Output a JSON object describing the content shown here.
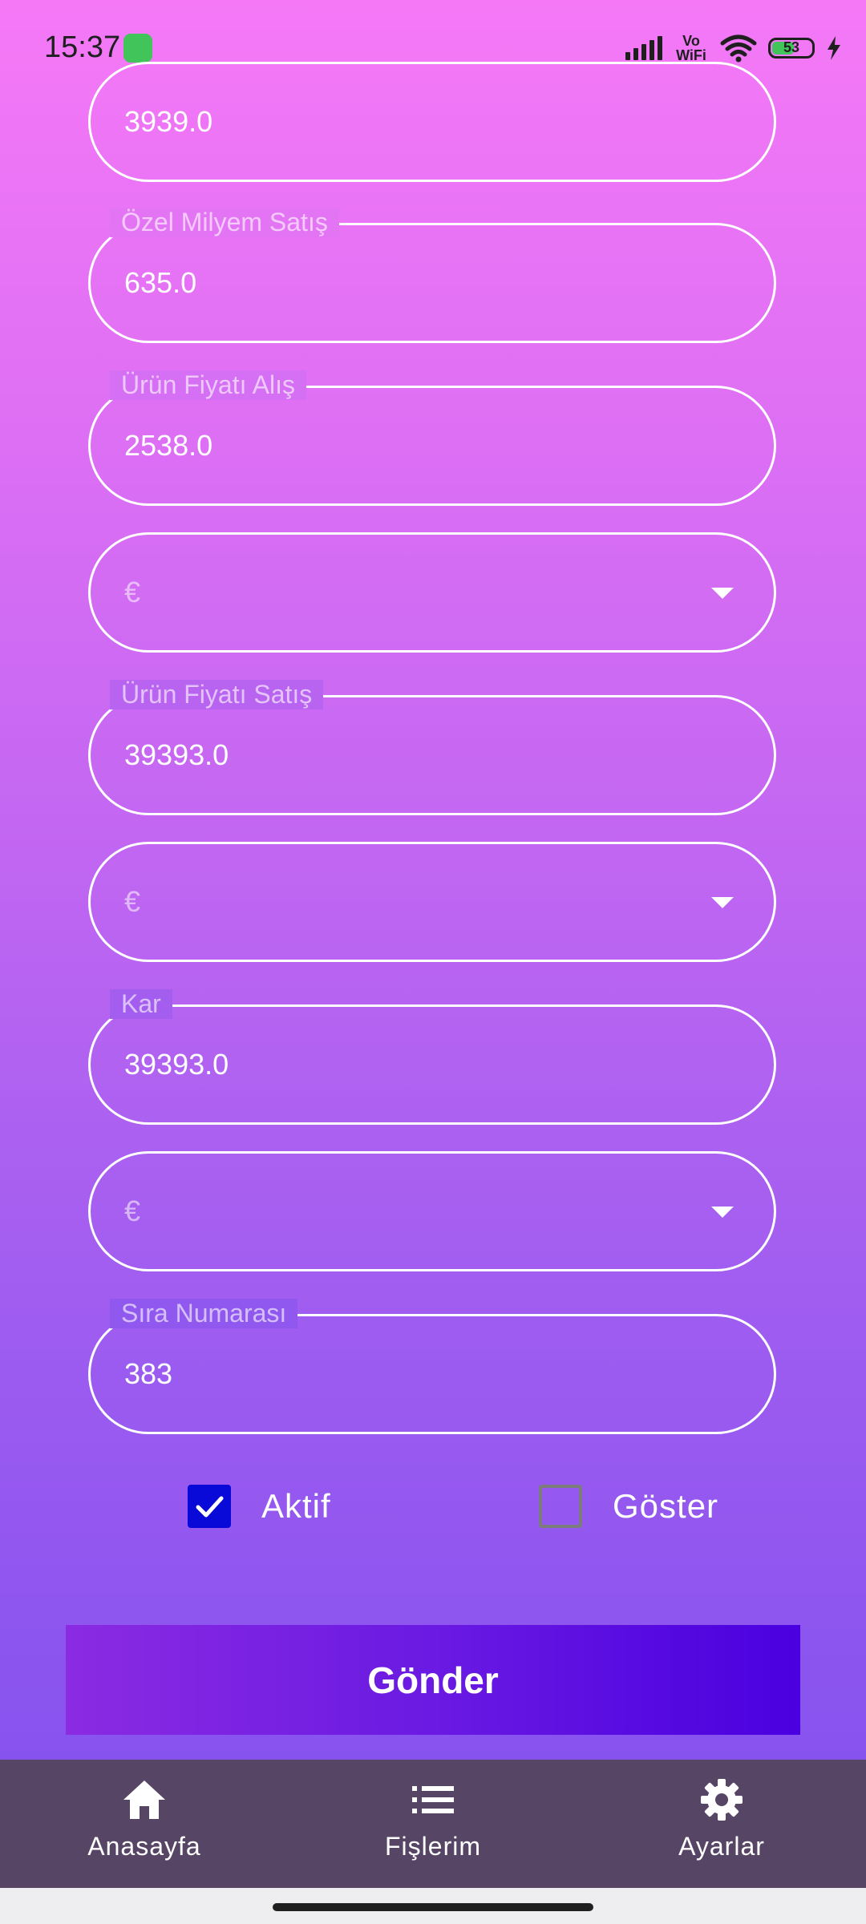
{
  "status_bar": {
    "time": "15:37",
    "network": "Vo WiFi",
    "battery_level": "53"
  },
  "form": {
    "fields": [
      {
        "label": "",
        "value": "3939.0"
      },
      {
        "label": "Özel Milyem Satış",
        "value": "635.0"
      },
      {
        "label": "Ürün Fiyatı Alış",
        "value": "2538.0"
      },
      {
        "label": "",
        "value": "€",
        "type": "dropdown"
      },
      {
        "label": "Ürün Fiyatı Satış",
        "value": "39393.0"
      },
      {
        "label": "",
        "value": "€",
        "type": "dropdown"
      },
      {
        "label": "Kar",
        "value": "39393.0"
      },
      {
        "label": "",
        "value": "€",
        "type": "dropdown"
      },
      {
        "label": "Sıra Numarası",
        "value": "383"
      }
    ],
    "checkboxes": [
      {
        "label": "Aktif",
        "checked": true
      },
      {
        "label": "Göster",
        "checked": false
      }
    ],
    "submit_label": "Gönder"
  },
  "bottom_nav": {
    "items": [
      {
        "label": "Anasayfa",
        "icon": "home-icon"
      },
      {
        "label": "Fişlerim",
        "icon": "list-icon"
      },
      {
        "label": "Ayarlar",
        "icon": "gear-icon"
      }
    ]
  },
  "colors": {
    "checkbox_checked": "#0a0ad8",
    "bottom_nav_bg": "#574566",
    "button_gradient_start": "#8b2be2",
    "button_gradient_end": "#4a00e0"
  }
}
